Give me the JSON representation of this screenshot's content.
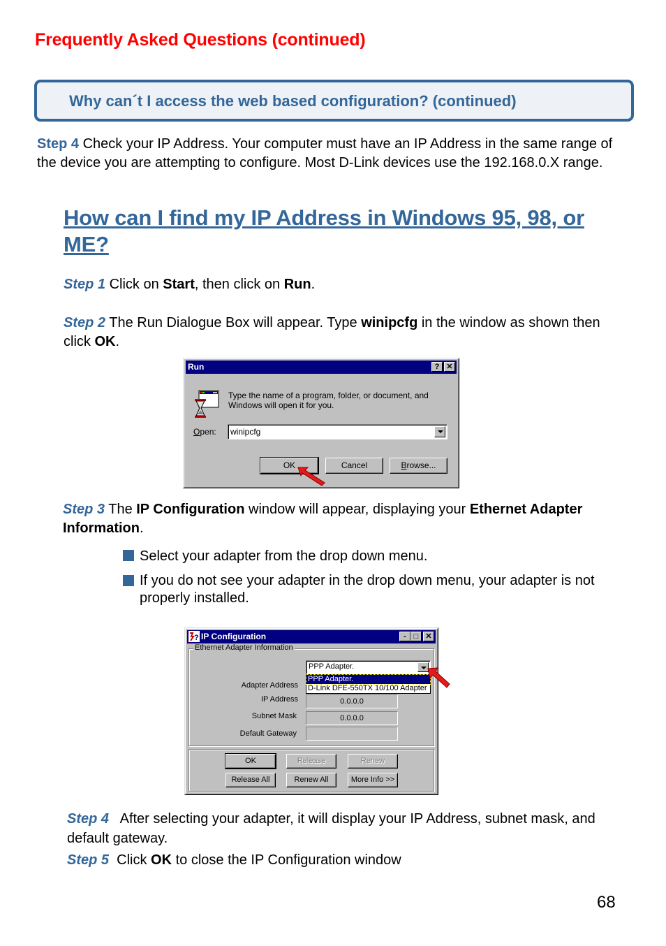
{
  "page": {
    "section_title": "Frequently Asked Questions (continued)",
    "question_box": "Why can´t I access the web based configuration? (continued)",
    "intro_step": {
      "label": "Step 4",
      "text": " Check your IP Address. Your computer must have an IP Address in the same range of the device you are attempting to configure. Most D-Link devices use the 192.168.0.X range."
    },
    "heading_link": "How can I find my IP Address in Windows 95, 98, or ME? ",
    "steps": [
      {
        "label": "Step 1",
        "parts": [
          " Click on ",
          "Start",
          ", then click on ",
          "Run",
          "."
        ]
      },
      {
        "label": "Step 2",
        "parts": [
          " The Run Dialogue Box will appear. Type ",
          "winipcfg",
          " in the window as shown then click ",
          "OK",
          "."
        ]
      },
      {
        "label": "Step 3",
        "parts": [
          " The ",
          "IP Configuration",
          " window will appear, displaying your ",
          "Ethernet Adapter Information",
          "."
        ]
      },
      {
        "label": "Step 4",
        "parts": [
          "   After selecting your adapter, it will display your IP Address, subnet mask, and default gateway."
        ]
      },
      {
        "label": "Step 5",
        "parts": [
          "  Click ",
          "OK",
          " to close the IP Configuration window"
        ]
      }
    ],
    "bullets": [
      "Select your adapter from the drop down menu.",
      "If you do not see your adapter in the drop down menu, your adapter is not properly installed."
    ],
    "page_number": "68",
    "colors": {
      "accent_blue": "#336699",
      "title_red": "#ff0000",
      "win_titlebar": "#000080",
      "win_face": "#c0c0c0"
    }
  },
  "run_dialog": {
    "title": "Run",
    "help_icon": "?",
    "close_icon": "✕",
    "description_line1": "Type the name of a program, folder, or document, and",
    "description_line2": "Windows will open it for you.",
    "open_label_prefix": "O",
    "open_label_rest": "pen:",
    "open_value": "winipcfg",
    "buttons": {
      "ok": "OK",
      "cancel": "Cancel",
      "browse_prefix": "B",
      "browse_rest": "rowse..."
    }
  },
  "ipconfig_dialog": {
    "title": "IP Configuration",
    "group_label": "Ethernet  Adapter Information",
    "selected_adapter": "PPP Adapter.",
    "dropdown_options": [
      "PPP Adapter.",
      "D-Link DFE-550TX 10/100 Adapter"
    ],
    "fields": [
      {
        "label": "Adapter Address",
        "value": ""
      },
      {
        "label": "IP Address",
        "value": "0.0.0.0"
      },
      {
        "label": "Subnet Mask",
        "value": "0.0.0.0"
      },
      {
        "label": "Default Gateway",
        "value": ""
      }
    ],
    "buttons": {
      "ok": "OK",
      "release": "Release",
      "renew": "Renew",
      "release_all": "Release All",
      "renew_all": "Renew All",
      "more_info": "More Info >>"
    }
  }
}
